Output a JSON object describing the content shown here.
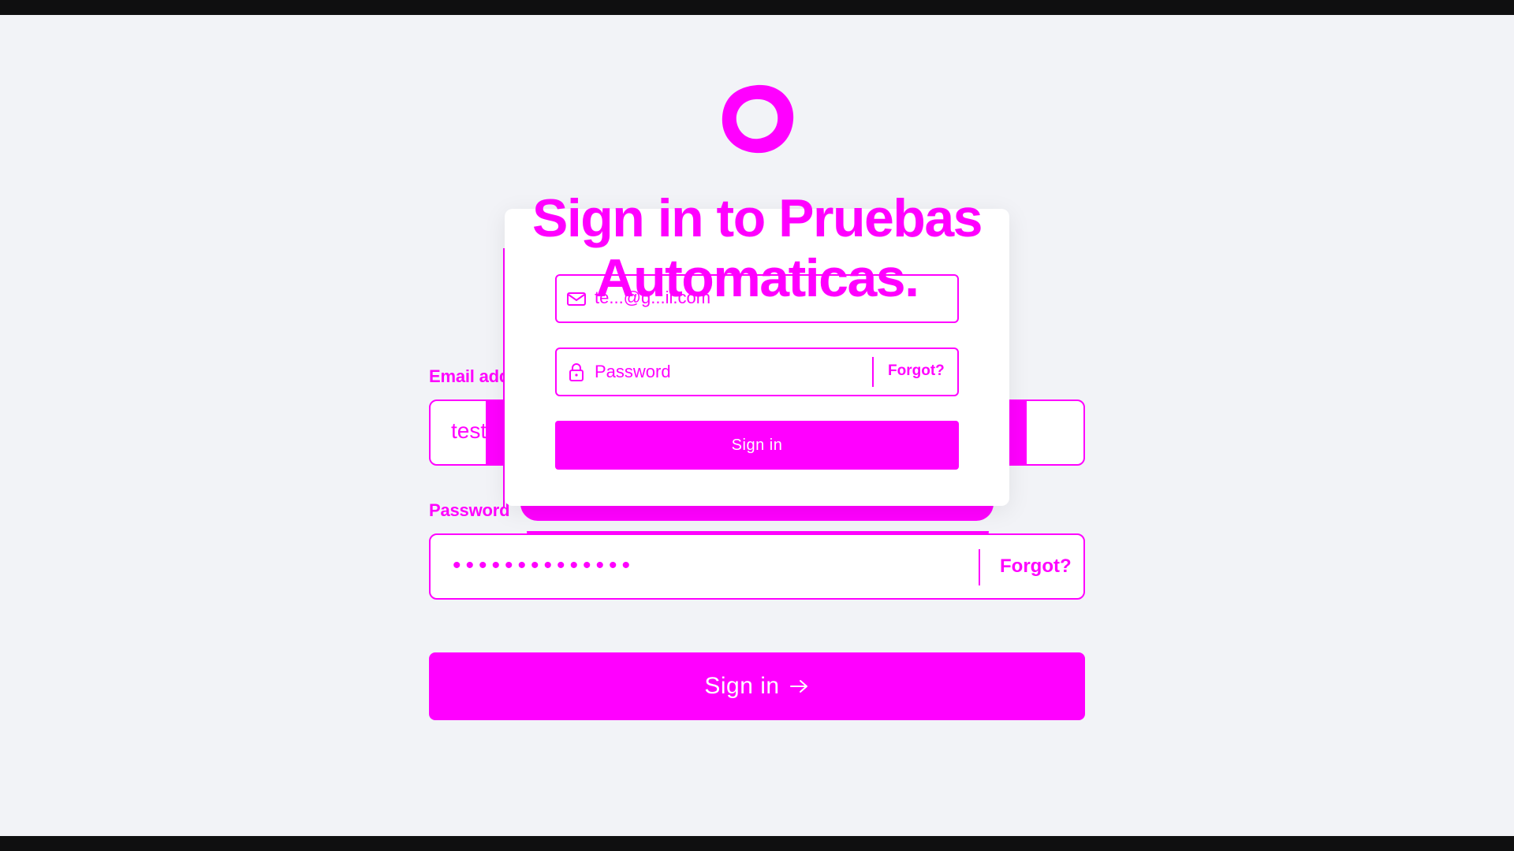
{
  "title": "Sign in to Pruebas Automaticas.",
  "main_form": {
    "email_label": "Email address",
    "email_value": "testerJuni",
    "password_label": "Password",
    "password_value": "••••••••••••••",
    "forgot_label": "Forgot?",
    "signin_label": "Sign in",
    "signin_arrow": "→"
  },
  "card_form": {
    "email_value": "te...@g...il.com",
    "password_placeholder": "Password",
    "forgot_label": "Forgot?",
    "signin_label": "Sign in"
  },
  "icons": {
    "logo": "logo-ring-icon",
    "email": "envelope-icon",
    "password": "lock-icon",
    "arrow": "arrow-right-icon"
  },
  "colors": {
    "accent": "#ff00ff",
    "background": "#f2f3f7",
    "card": "#ffffff",
    "frame": "#0f0f10"
  }
}
